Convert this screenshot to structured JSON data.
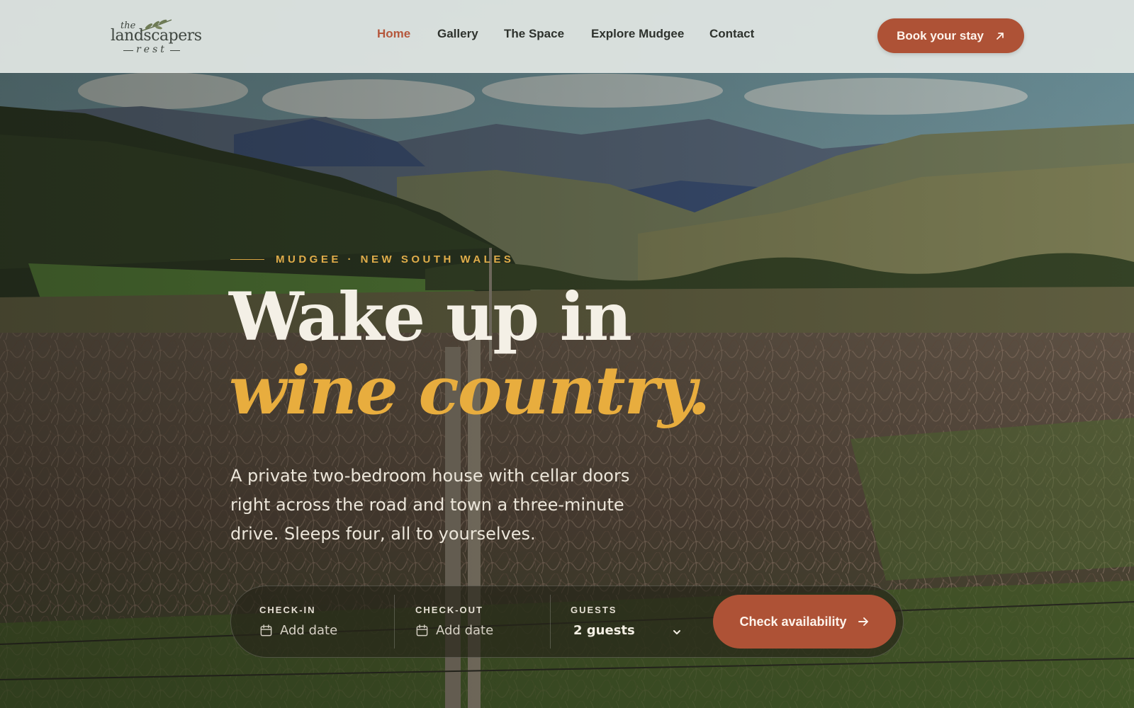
{
  "brand": {
    "logo_the": "the",
    "logo_main": "landscapers",
    "logo_rest": "rest"
  },
  "nav": {
    "items": [
      {
        "label": "Home",
        "active": true
      },
      {
        "label": "Gallery",
        "active": false
      },
      {
        "label": "The Space",
        "active": false
      },
      {
        "label": "Explore Mudgee",
        "active": false
      },
      {
        "label": "Contact",
        "active": false
      }
    ],
    "cta_label": "Book your stay",
    "cta_icon": "arrow-up-right-icon"
  },
  "hero": {
    "eyebrow": "MUDGEE · NEW SOUTH WALES",
    "headline_line1": "Wake up in",
    "headline_line2": "wine country.",
    "description": "A private two-bedroom house with cellar doors right across the road and town a three-minute drive. Sleeps four, all to yourselves."
  },
  "booking": {
    "checkin": {
      "label": "CHECK-IN",
      "value": "Add date",
      "icon": "calendar-icon"
    },
    "checkout": {
      "label": "CHECK-OUT",
      "value": "Add date",
      "icon": "calendar-icon"
    },
    "guests": {
      "label": "GUESTS",
      "value": "2 guests",
      "icon": "chevron-down-icon"
    },
    "submit_label": "Check availability",
    "submit_icon": "arrow-right-icon"
  },
  "colors": {
    "accent": "#ae5236",
    "gold": "#e8ad3e",
    "nav_active": "#b5573c"
  }
}
